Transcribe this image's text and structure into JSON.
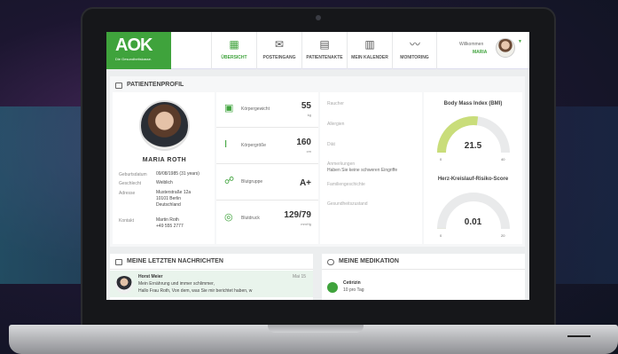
{
  "header": {
    "logo_brand": "AOK",
    "logo_tagline": "Die Gesundheitskasse.",
    "nav": [
      {
        "label": "ÜBERSICHT",
        "icon": "grid-icon",
        "active": true
      },
      {
        "label": "POSTEINGANG",
        "icon": "mail-icon",
        "active": false
      },
      {
        "label": "PATIENTENAKTE",
        "icon": "file-icon",
        "active": false
      },
      {
        "label": "MEIN KALENDER",
        "icon": "calendar-icon",
        "active": false
      },
      {
        "label": "MONITORING",
        "icon": "chart-icon",
        "active": false
      }
    ],
    "welcome": "Willkommen",
    "user_name": "MARIA"
  },
  "profile": {
    "section_title": "PATIENTENPROFIL",
    "name": "MARIA ROTH",
    "fields": [
      {
        "label": "Geburtsdatum",
        "value": "09/08/1985 (31 years)"
      },
      {
        "label": "Geschlecht",
        "value": "Weiblich"
      },
      {
        "label": "Adresse",
        "value": "Musterstraße 12a\n10101 Berlin\nDeutschland"
      },
      {
        "label": "Kontakt",
        "value": "Martin Roth\n+49 555 2777"
      }
    ]
  },
  "vitals": [
    {
      "label": "Körpergewicht",
      "value": "55",
      "unit": "kg",
      "icon": "scale-icon"
    },
    {
      "label": "Körpergröße",
      "value": "160",
      "unit": "cm",
      "icon": "height-icon"
    },
    {
      "label": "Blutgruppe",
      "value": "A+",
      "unit": "",
      "icon": "blood-icon"
    },
    {
      "label": "Blutdruck",
      "value": "129/79",
      "unit": "mmHg",
      "icon": "pressure-icon"
    }
  ],
  "info": [
    {
      "label": "Raucher",
      "value": ""
    },
    {
      "label": "Allergien",
      "value": ""
    },
    {
      "label": "Diät",
      "value": ""
    },
    {
      "label": "Anmerkungen",
      "value": "Haben Sie keine schweren Eingriffe"
    },
    {
      "label": "Familiengeschichte",
      "value": ""
    },
    {
      "label": "Gesundheitszustand",
      "value": ""
    }
  ],
  "bmi": {
    "title": "Body Mass Index (BMI)",
    "value": "21.5",
    "min": "0",
    "max": "40",
    "fraction": 0.54,
    "color": "#c9dd7a"
  },
  "risk": {
    "title": "Herz-Kreislauf-Risiko-Score",
    "value": "0.01",
    "min": "0",
    "max": "20",
    "fraction": 0.0005,
    "color": "#c9dd7a"
  },
  "messages": {
    "section_title": "MEINE LETZTEN NACHRICHTEN",
    "items": [
      {
        "sender": "Horst Meier",
        "date": "Mai 15",
        "line1": "Mein Ernährung und immer schlimmer,",
        "line2": "Hallo Frau Roth, Von dem, was Sie mir berichtet haben, w"
      }
    ]
  },
  "medication": {
    "section_title": "MEINE MEDIKATION",
    "items": [
      {
        "name": "Cetirizin",
        "dose": "10 pro Tag"
      }
    ]
  },
  "colors": {
    "accent": "#3fa33c"
  }
}
